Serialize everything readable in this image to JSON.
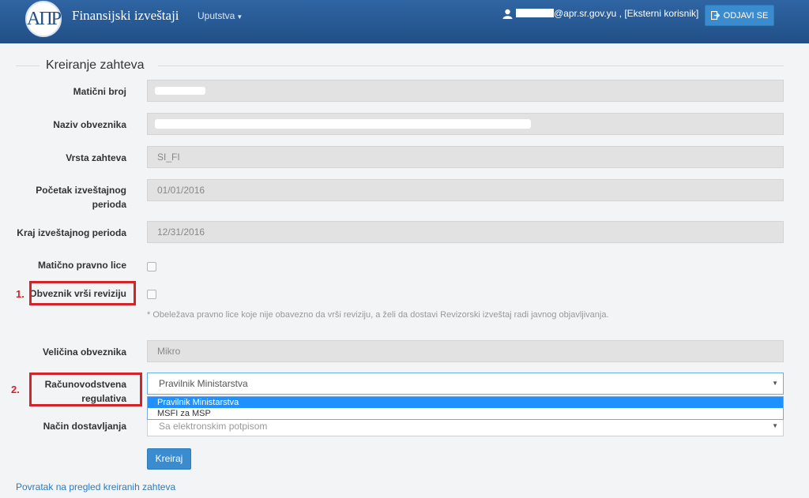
{
  "header": {
    "logo_text": "AΠP",
    "title": "Finansijski izveštaji",
    "menu_label": "Uputstva",
    "user_text": "@apr.sr.gov.yu , [Eksterni korisnik]",
    "logout_label": "ODJAVI SE"
  },
  "form": {
    "legend": "Kreiranje zahteva",
    "fields": {
      "maticni_broj": {
        "label": "Matični broj",
        "value": ""
      },
      "naziv": {
        "label": "Naziv obveznika",
        "value": ""
      },
      "vrsta": {
        "label": "Vrsta zahteva",
        "value": "SI_FI"
      },
      "pocetak": {
        "label": "Početak izveštajnog perioda",
        "value": "01/01/2016"
      },
      "kraj": {
        "label": "Kraj izveštajnog perioda",
        "value": "12/31/2016"
      },
      "maticno_pravno_lice": {
        "label": "Matično pravno lice",
        "checked": false
      },
      "revizija": {
        "label": "Obveznik vrši reviziju",
        "checked": false
      },
      "hint": "* Obeležava pravno lice koje nije obavezno da vrši reviziju, a želi da dostavi Revizorski izveštaj radi javnog objavljivanja.",
      "velicina": {
        "label": "Veličina obveznika",
        "value": "Mikro"
      },
      "regulativa": {
        "label": "Računovodstvena regulativa",
        "value": "Pravilnik Ministarstva",
        "options": [
          "Pravilnik Ministarstva",
          "MSFI za MSP"
        ]
      },
      "nacin": {
        "label": "Način dostavljanja",
        "value": "Sa elektronskim potpisom"
      }
    },
    "submit_label": "Kreiraj",
    "back_link": "Povratak na pregled kreiranih zahteva"
  },
  "annotations": {
    "first": "1.",
    "second": "2."
  },
  "colors": {
    "navbar": "#2a5c97",
    "primary_button": "#3a8ccf",
    "annotation": "#d4242a",
    "selected_option": "#1e90ff"
  }
}
